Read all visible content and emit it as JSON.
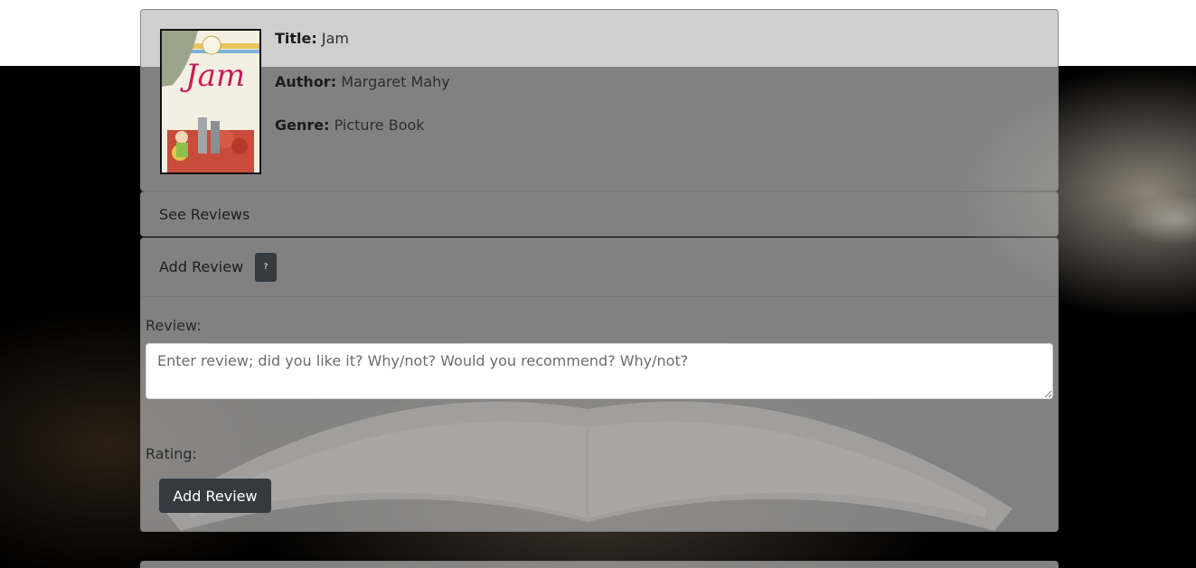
{
  "book": {
    "title_label": "Title:",
    "title": "Jam",
    "author_label": "Author:",
    "author": "Margaret Mahy",
    "genre_label": "Genre:",
    "genre": "Picture Book",
    "cover_text": "Jam"
  },
  "see_reviews": {
    "label": "See Reviews"
  },
  "add_review": {
    "header_label": "Add Review",
    "help_label": "?",
    "review_label": "Review:",
    "review_placeholder": "Enter review; did you like it? Why/not? Would you recommend? Why/not?",
    "review_value": "",
    "rating_label": "Rating:",
    "submit_label": "Add Review"
  },
  "colors": {
    "button_dark": "#343a40",
    "card_bg": "#a5a5a5",
    "background": "#000000"
  }
}
